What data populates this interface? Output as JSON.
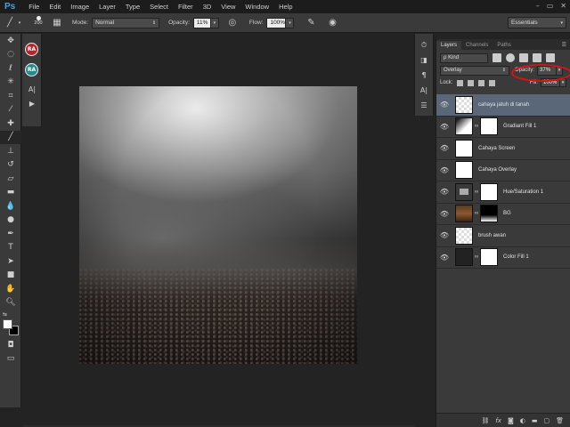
{
  "app": {
    "logo": "Ps"
  },
  "menu": [
    "File",
    "Edit",
    "Image",
    "Layer",
    "Type",
    "Select",
    "Filter",
    "3D",
    "View",
    "Window",
    "Help"
  ],
  "window_controls": [
    "–",
    "▭",
    "✕"
  ],
  "options": {
    "brush_size": "200",
    "mode_label": "Mode:",
    "mode_value": "Normal",
    "opacity_label": "Opacity:",
    "opacity_value": "11%",
    "flow_label": "Flow:",
    "flow_value": "100%",
    "workspace": "Essentials"
  },
  "minipanel": {
    "badge_top": "RA",
    "badge_bottom": "RA",
    "badge_top_color": "#b5262f",
    "badge_bottom_color": "#2a8a8a"
  },
  "layers_panel": {
    "tabs": [
      "Layers",
      "Channels",
      "Paths"
    ],
    "filter_label": "ρ Kind",
    "blend_mode": "Overlay",
    "opacity_label": "Opacity:",
    "opacity_value": "37%",
    "lock_label": "Lock:",
    "fill_label": "Fill:",
    "fill_value": "100%",
    "layers": [
      {
        "name": "cahaya jatuh di tanah",
        "thumb": "checker",
        "mask": null,
        "selected": true
      },
      {
        "name": "Gradiant Fill 1",
        "thumb": "grad",
        "mask": "white",
        "selected": false
      },
      {
        "name": "Cahaya Screen",
        "thumb": "white",
        "mask": null,
        "selected": false
      },
      {
        "name": "Cahaya Overlay",
        "thumb": "white",
        "mask": null,
        "selected": false
      },
      {
        "name": "Hue/Saturation 1",
        "thumb": "hue",
        "mask": "white",
        "selected": false
      },
      {
        "name": "BG",
        "thumb": "bg",
        "mask": "mask-black",
        "selected": false
      },
      {
        "name": "brush awan",
        "thumb": "checker",
        "mask": null,
        "selected": false
      },
      {
        "name": "Color Fill 1",
        "thumb": "dark",
        "mask": "white",
        "selected": false
      }
    ],
    "bottom_icons": [
      "link-icon",
      "fx-icon",
      "mask-icon",
      "adjustment-icon",
      "folder-icon",
      "new-layer-icon",
      "trash-icon"
    ]
  },
  "highlight_color": "#dd1111",
  "selection_color": "#596778"
}
